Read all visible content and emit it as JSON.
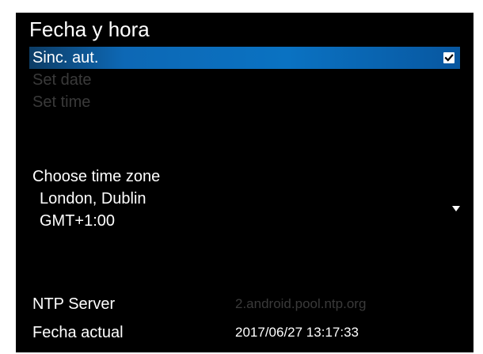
{
  "panel": {
    "title": "Fecha y hora"
  },
  "options": {
    "auto_sync": {
      "label": "Sinc. aut.",
      "checked": true
    },
    "set_date": {
      "label": "Set date",
      "enabled": false
    },
    "set_time": {
      "label": "Set time",
      "enabled": false
    }
  },
  "timezone": {
    "heading": "Choose time zone",
    "city": "London, Dublin",
    "offset": "GMT+1:00"
  },
  "ntp": {
    "label": "NTP Server",
    "value": "2.android.pool.ntp.org"
  },
  "current_date": {
    "label": "Fecha actual",
    "value": "2017/06/27 13:17:33"
  },
  "colors": {
    "background": "#000000",
    "highlight": "#0a72c2",
    "text": "#ffffff",
    "disabled_text": "#3a3a3a"
  }
}
